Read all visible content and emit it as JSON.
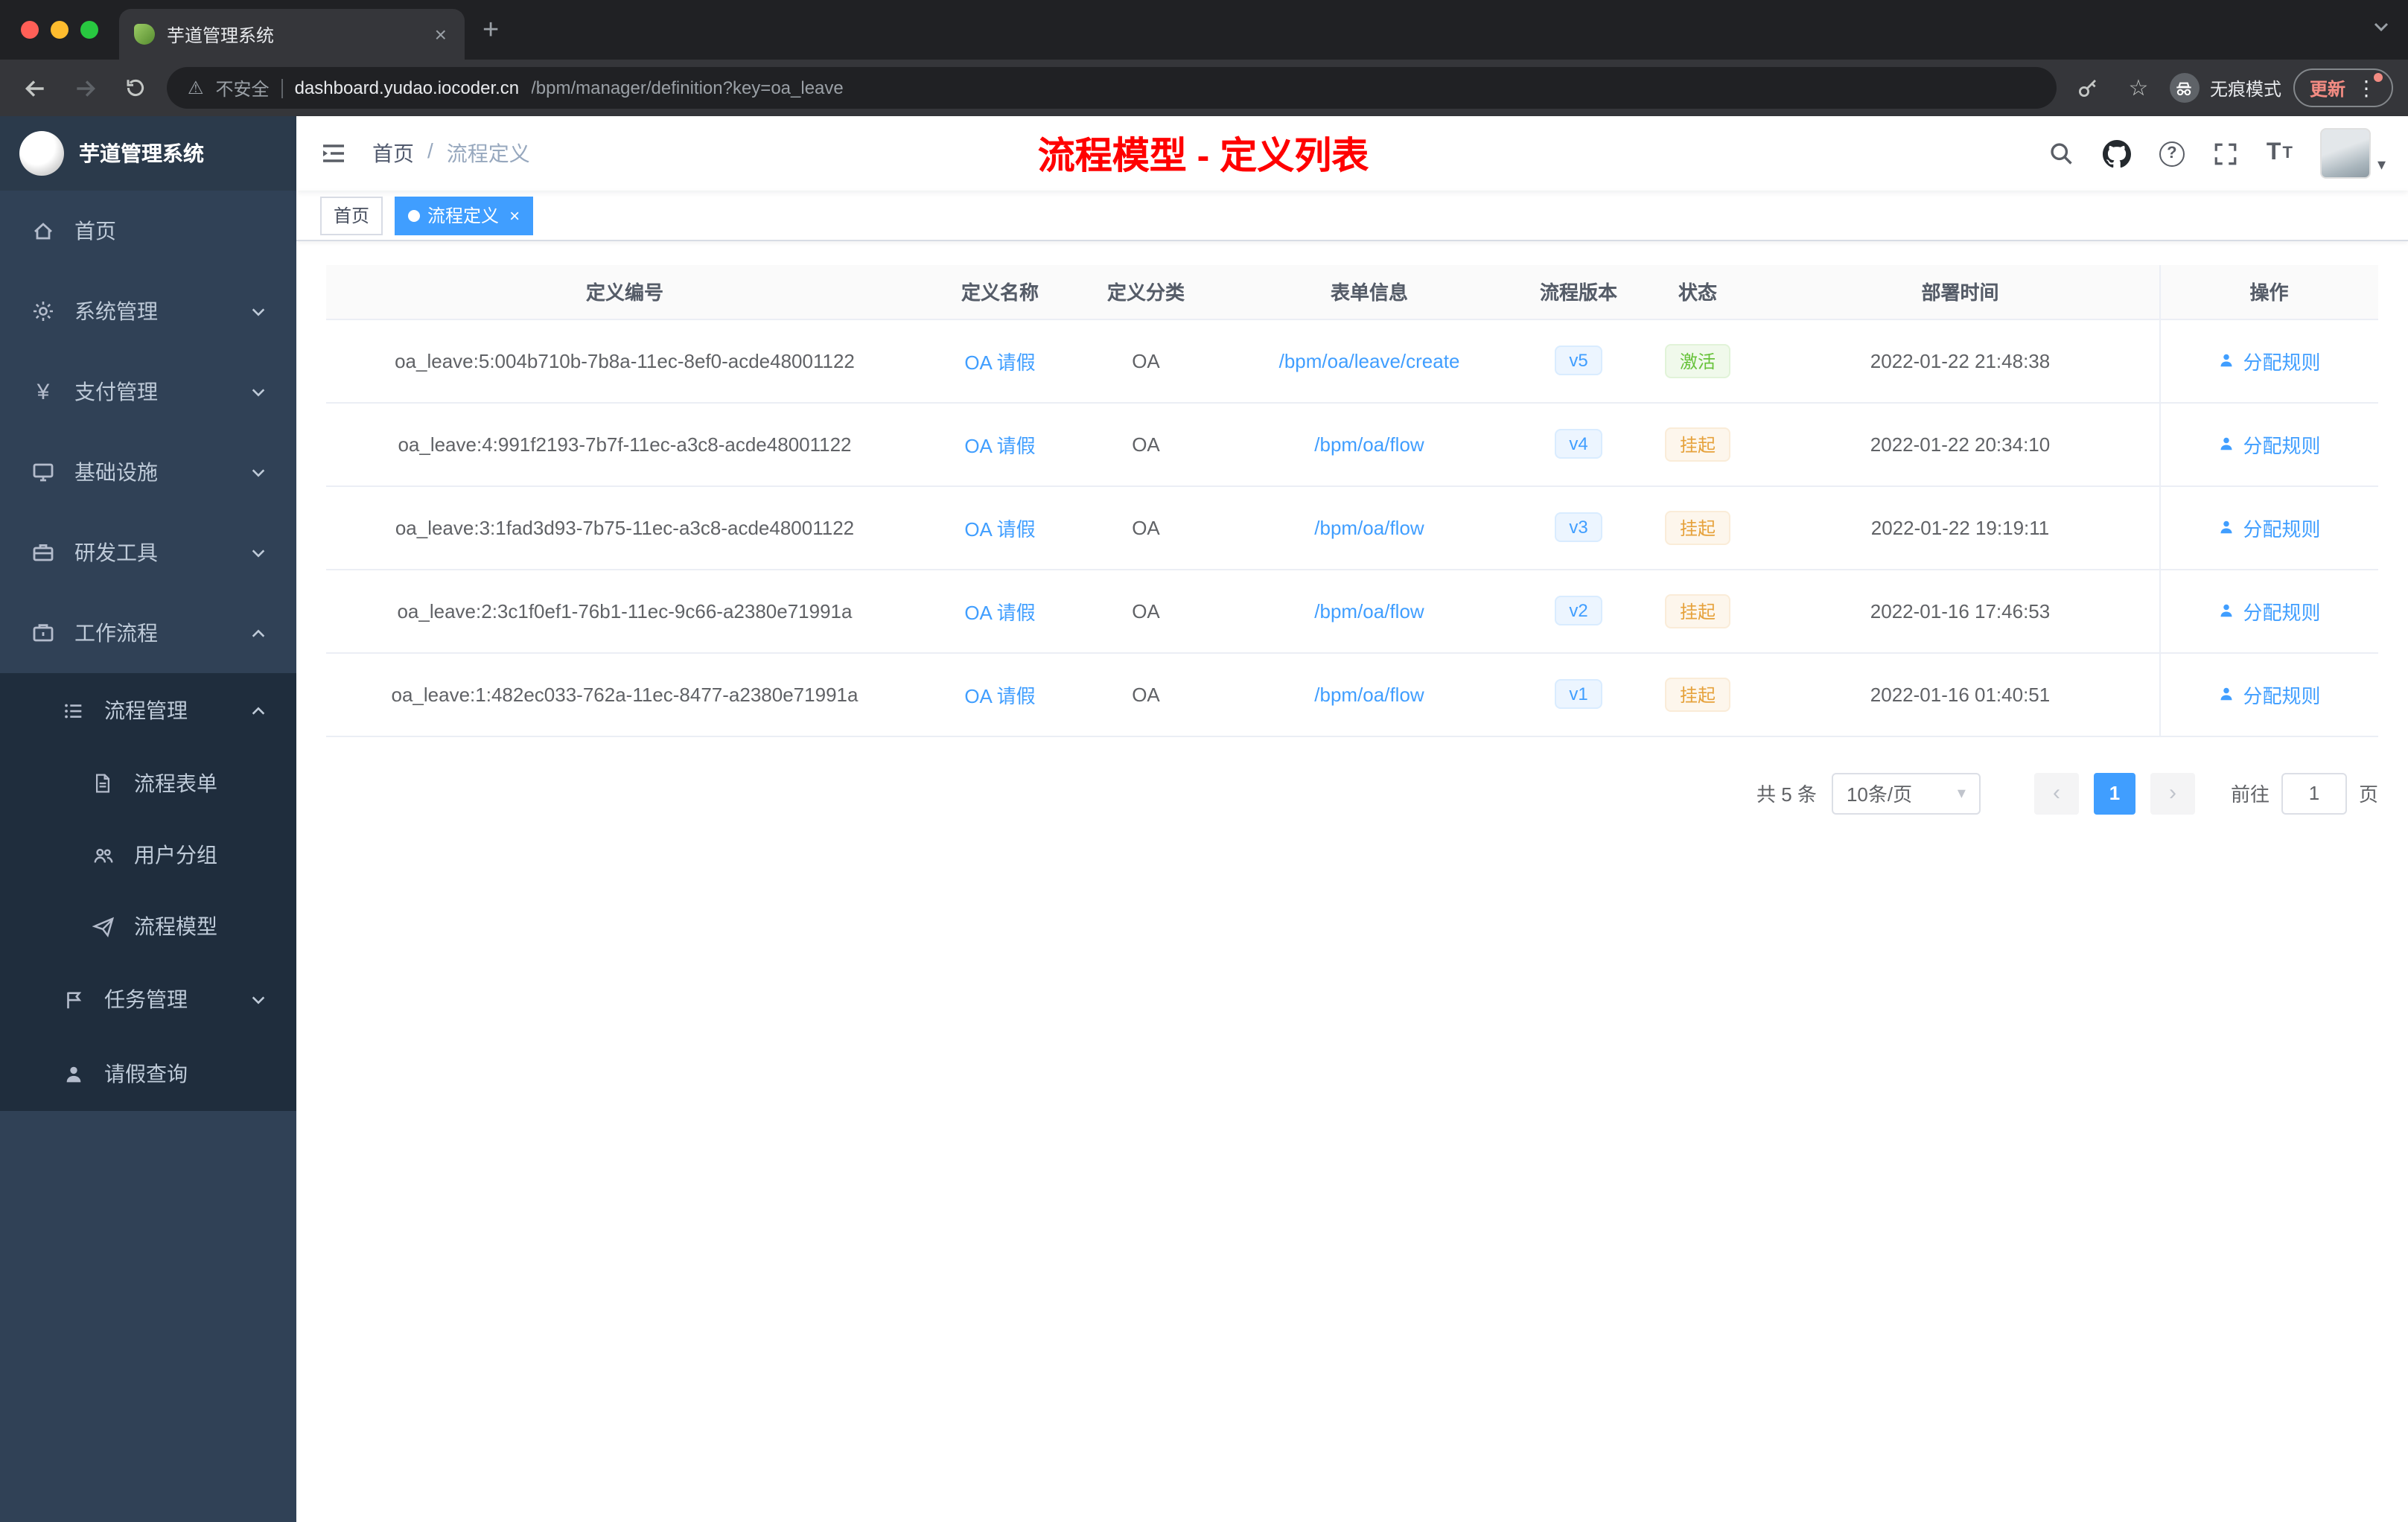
{
  "colors": {
    "accent": "#409eff",
    "title_red": "#ff0000",
    "success": "#67c23a",
    "warning": "#e6a23c",
    "sidebar_bg": "#304156",
    "submenu_bg": "#1f2d3d"
  },
  "icons": {
    "tab_close": "×",
    "new_tab": "+",
    "star": "☆",
    "kebab": "⋮",
    "warning": "⚠",
    "question": "?",
    "yen": "¥",
    "font_large": "T",
    "font_small": "T",
    "avatar_caret": "▾",
    "select_caret": "▾",
    "prev": "‹",
    "next": "›",
    "tag_close": "×"
  },
  "browser": {
    "tab_title": "芋道管理系统",
    "security": "不安全",
    "url_domain": "dashboard.yudao.iocoder.cn",
    "url_path": "/bpm/manager/definition?key=oa_leave",
    "incognito": "无痕模式",
    "update": "更新"
  },
  "sidebar": {
    "brand": "芋道管理系统",
    "menu": [
      {
        "label": "首页"
      },
      {
        "label": "系统管理"
      },
      {
        "label": "支付管理"
      },
      {
        "label": "基础设施"
      },
      {
        "label": "研发工具"
      },
      {
        "label": "工作流程"
      }
    ],
    "process_group": {
      "label": "流程管理",
      "children": [
        {
          "label": "流程表单"
        },
        {
          "label": "用户分组"
        },
        {
          "label": "流程模型"
        }
      ]
    },
    "task_group": {
      "label": "任务管理"
    },
    "leave_item": {
      "label": "请假查询"
    }
  },
  "navbar": {
    "breadcrumb_home": "首页",
    "breadcrumb_sep": "/",
    "breadcrumb_current": "流程定义",
    "title": "流程模型 - 定义列表"
  },
  "tags": {
    "home": "首页",
    "current": "流程定义"
  },
  "table": {
    "columns": [
      "定义编号",
      "定义名称",
      "定义分类",
      "表单信息",
      "流程版本",
      "状态",
      "部署时间",
      "操作"
    ],
    "rows": [
      {
        "id": "oa_leave:5:004b710b-7b8a-11ec-8ef0-acde48001122",
        "name": "OA 请假",
        "category": "OA",
        "form": "/bpm/oa/leave/create",
        "version": "v5",
        "status": "激活",
        "time": "2022-01-22 21:48:38",
        "action": "分配规则"
      },
      {
        "id": "oa_leave:4:991f2193-7b7f-11ec-a3c8-acde48001122",
        "name": "OA 请假",
        "category": "OA",
        "form": "/bpm/oa/flow",
        "version": "v4",
        "status": "挂起",
        "time": "2022-01-22 20:34:10",
        "action": "分配规则"
      },
      {
        "id": "oa_leave:3:1fad3d93-7b75-11ec-a3c8-acde48001122",
        "name": "OA 请假",
        "category": "OA",
        "form": "/bpm/oa/flow",
        "version": "v3",
        "status": "挂起",
        "time": "2022-01-22 19:19:11",
        "action": "分配规则"
      },
      {
        "id": "oa_leave:2:3c1f0ef1-76b1-11ec-9c66-a2380e71991a",
        "name": "OA 请假",
        "category": "OA",
        "form": "/bpm/oa/flow",
        "version": "v2",
        "status": "挂起",
        "time": "2022-01-16 17:46:53",
        "action": "分配规则"
      },
      {
        "id": "oa_leave:1:482ec033-762a-11ec-8477-a2380e71991a",
        "name": "OA 请假",
        "category": "OA",
        "form": "/bpm/oa/flow",
        "version": "v1",
        "status": "挂起",
        "time": "2022-01-16 01:40:51",
        "action": "分配规则"
      }
    ]
  },
  "pagination": {
    "total": "共 5 条",
    "size": "10条/页",
    "page": "1",
    "goto": "前往",
    "goto_value": "1",
    "unit": "页"
  }
}
